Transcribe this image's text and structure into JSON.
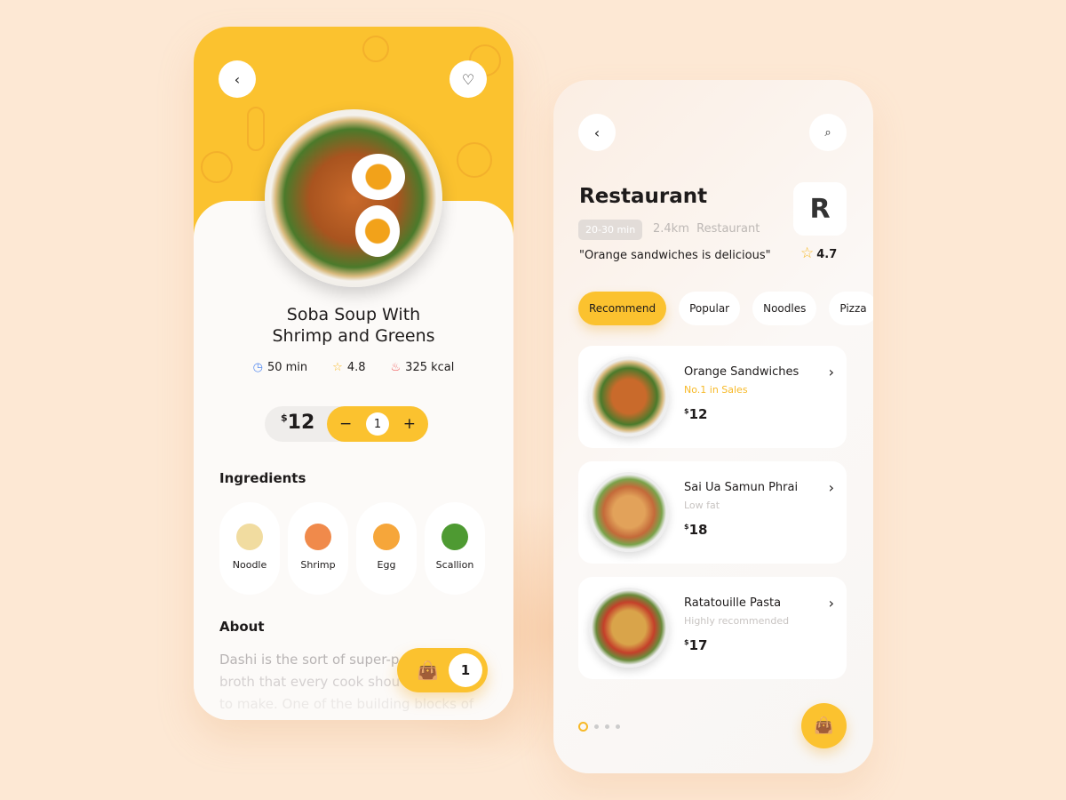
{
  "detail": {
    "back_icon": "chevron-left-icon",
    "favorite_icon": "heart-icon",
    "title_line1": "Soba Soup With",
    "title_line2": "Shrimp and Greens",
    "time": "50 min",
    "rating": "4.8",
    "calories": "325 kcal",
    "currency": "$",
    "price": "12",
    "minus": "−",
    "quantity": "1",
    "plus": "+",
    "ingredients_heading": "Ingredients",
    "ingredients": [
      {
        "label": "Noodle",
        "color": "#f1dca0"
      },
      {
        "label": "Shrimp",
        "color": "#f08a4b"
      },
      {
        "label": "Egg",
        "color": "#f6a63a"
      },
      {
        "label": "Scallion",
        "color": "#4e9a32"
      }
    ],
    "about_heading": "About",
    "about_lines": [
      "Dashi is the sort of super-p",
      "broth that every cook shou",
      "to make. One of the building blocks of"
    ],
    "cart_count": "1"
  },
  "restaurant": {
    "title": "Restaurant",
    "time_chip": "20-30 min",
    "distance": "2.4km",
    "type": "Restaurant",
    "quote": "\"Orange sandwiches is delicious\"",
    "logo": "R",
    "rating": "4.7",
    "tabs": [
      "Recommend",
      "Popular",
      "Noodles",
      "Pizza"
    ],
    "items": [
      {
        "name": "Orange Sandwiches",
        "sub": "No.1 in Sales",
        "price": "12"
      },
      {
        "name": "Sai Ua Samun Phrai",
        "sub": "Low fat",
        "price": "18"
      },
      {
        "name": "Ratatouille Pasta",
        "sub": "Highly recommended",
        "price": "17"
      }
    ],
    "currency": "$"
  },
  "colors": {
    "accent": "#fbc22f",
    "background": "#fde8d4"
  }
}
